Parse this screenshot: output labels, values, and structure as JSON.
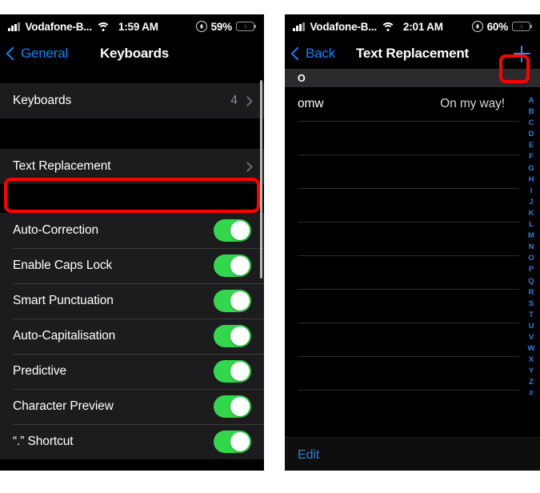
{
  "left_phone": {
    "status_bar": {
      "carrier": "Vodafone-B...",
      "time": "1:59 AM",
      "battery_percent": "59%",
      "signal_icon": "signal-bars-icon",
      "wifi_icon": "wifi-icon",
      "lock_icon": "screen-lock-rotation-icon",
      "battery_icon": "battery-charging-icon"
    },
    "nav": {
      "back_label": "General",
      "title": "Keyboards",
      "back_icon": "chevron-left-icon"
    },
    "sections": [
      {
        "rows": [
          {
            "label": "Keyboards",
            "value": "4",
            "type": "disclosure"
          }
        ]
      },
      {
        "rows": [
          {
            "label": "Text Replacement",
            "value": "",
            "type": "disclosure",
            "highlighted": true
          }
        ]
      },
      {
        "rows": [
          {
            "label": "Auto-Correction",
            "type": "switch",
            "on": true
          },
          {
            "label": "Enable Caps Lock",
            "type": "switch",
            "on": true
          },
          {
            "label": "Smart Punctuation",
            "type": "switch",
            "on": true
          },
          {
            "label": "Auto-Capitalisation",
            "type": "switch",
            "on": true
          },
          {
            "label": "Predictive",
            "type": "switch",
            "on": true
          },
          {
            "label": "Character Preview",
            "type": "switch",
            "on": true
          },
          {
            "label": "“.” Shortcut",
            "type": "switch",
            "on": true
          }
        ]
      }
    ],
    "annotation": {
      "color": "#ff0000",
      "target": "Text Replacement"
    }
  },
  "right_phone": {
    "status_bar": {
      "carrier": "Vodafone-B...",
      "time": "2:01 AM",
      "battery_percent": "60%",
      "signal_icon": "signal-bars-icon",
      "wifi_icon": "wifi-icon",
      "lock_icon": "screen-lock-rotation-icon",
      "battery_icon": "battery-charging-icon"
    },
    "nav": {
      "back_label": "Back",
      "title": "Text Replacement",
      "back_icon": "chevron-left-icon",
      "add_icon": "plus-icon"
    },
    "section_header": "O",
    "entries": [
      {
        "shortcut": "omw",
        "phrase": "On my way!"
      }
    ],
    "empty_row_count": 9,
    "index_letters": [
      "A",
      "B",
      "C",
      "D",
      "E",
      "F",
      "G",
      "H",
      "I",
      "J",
      "K",
      "L",
      "M",
      "N",
      "O",
      "P",
      "Q",
      "R",
      "S",
      "T",
      "U",
      "V",
      "W",
      "X",
      "Y",
      "Z",
      "#"
    ],
    "toolbar": {
      "edit_label": "Edit"
    },
    "annotation": {
      "color": "#ff0000",
      "target": "add-entry-button"
    }
  }
}
